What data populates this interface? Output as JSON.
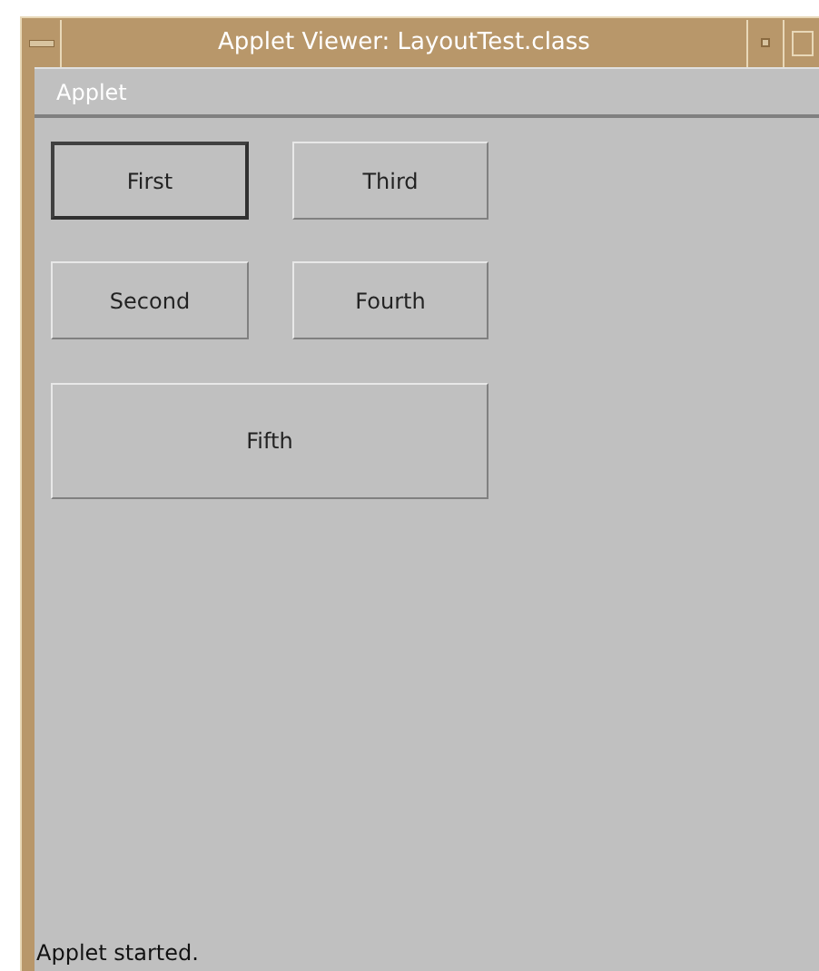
{
  "window": {
    "title": "Applet Viewer: LayoutTest.class"
  },
  "menu_bar": {
    "items": [
      "Applet"
    ]
  },
  "buttons": [
    {
      "label": "First",
      "focused": true,
      "kind": "small"
    },
    {
      "label": "Third",
      "focused": false,
      "kind": "small"
    },
    {
      "label": "Second",
      "focused": false,
      "kind": "small"
    },
    {
      "label": "Fourth",
      "focused": false,
      "kind": "small"
    },
    {
      "label": "Fifth",
      "focused": false,
      "kind": "wide"
    }
  ],
  "status_bar": "Applet started."
}
